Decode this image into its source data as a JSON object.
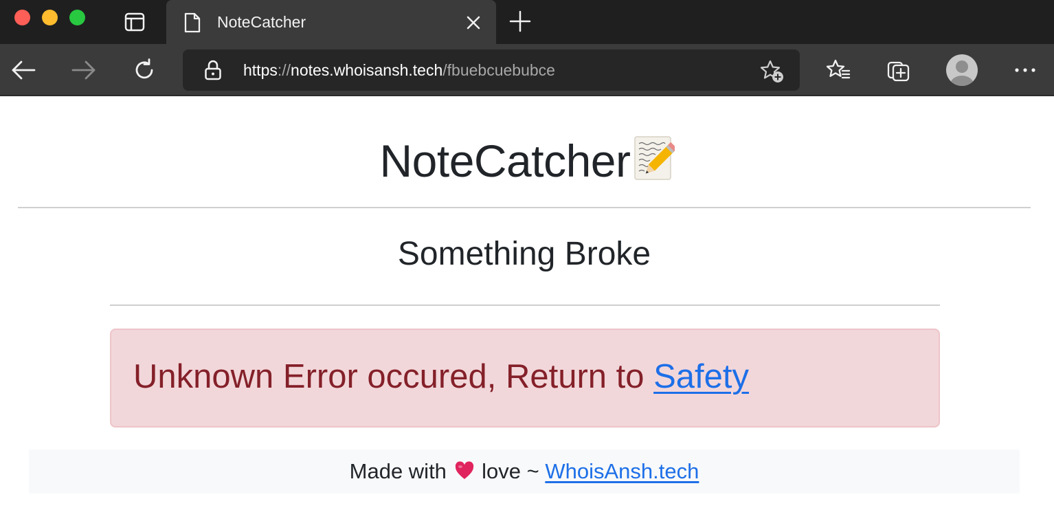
{
  "window": {
    "controls": [
      "close",
      "minimize",
      "zoom"
    ]
  },
  "tab": {
    "title": "NoteCatcher",
    "icon": "page-icon"
  },
  "toolbar": {
    "url_scheme": "https",
    "url_separator": "://",
    "url_host": "notes.whoisansh.tech",
    "url_path": "/fbuebcuebubce",
    "icons": [
      "back-arrow-icon",
      "forward-arrow-icon",
      "reload-icon",
      "lock-icon",
      "add-favorite-icon",
      "favorites-icon",
      "collections-icon",
      "profile-avatar",
      "more-icon"
    ]
  },
  "page": {
    "site_title": "NoteCatcher",
    "site_title_emoji": "memo-emoji",
    "section_title": "Something Broke",
    "alert_text": "Unknown Error occured, Return to ",
    "alert_link": "Safety",
    "footer_prefix": "Made with ",
    "footer_middle": " love ~ ",
    "footer_link": "WhoisAnsh.tech"
  },
  "colors": {
    "chrome_dark": "#1f1f1f",
    "chrome_tab": "#3b3b3b",
    "alert_bg": "#f2d7da",
    "alert_text": "#842029",
    "link": "#1d6fe8",
    "heart": "#e0245e"
  }
}
